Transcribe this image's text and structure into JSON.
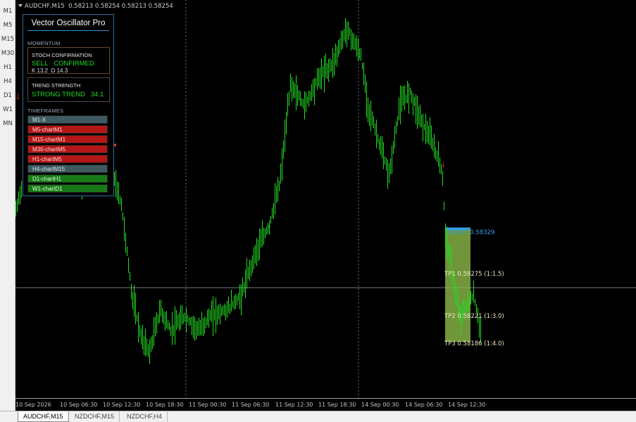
{
  "timeframes": [
    "M1",
    "M5",
    "M15",
    "M30",
    "H1",
    "H4",
    "D1",
    "W1",
    "MN"
  ],
  "chart": {
    "symbol": "AUDCHF,M15",
    "prices": "0.58213 0.58254 0.58213 0.58254"
  },
  "panel": {
    "title": "Vector Oscillator Pro",
    "momentum_label": "MOMENTUM",
    "stoch": {
      "heading": "STOCH CONFIRMATION",
      "signal": "SELL",
      "status": "CONFIRMED",
      "k": "K 13.2",
      "d": "D 14.3"
    },
    "trend": {
      "heading": "TREND STRENGTH",
      "status": "STRONG TREND",
      "value": "34.1"
    },
    "timeframes_label": "TIMEFRAMES",
    "tf_rows": [
      {
        "label": "M1-X",
        "state": "neutral"
      },
      {
        "label": "M5-chartM1",
        "state": "sell"
      },
      {
        "label": "M15-chartM1",
        "state": "sell"
      },
      {
        "label": "M30-chartM5",
        "state": "sell"
      },
      {
        "label": "H1-chartM5",
        "state": "sell"
      },
      {
        "label": "H4-chartM15",
        "state": "neutral"
      },
      {
        "label": "D1-chartH1",
        "state": "buy"
      },
      {
        "label": "W1-chartD1",
        "state": "buy"
      }
    ]
  },
  "levels": {
    "entry": "ENTRY 0.58329",
    "tp1": "TP1 0.58275 (1:1.5)",
    "tp2": "TP2 0.58221 (1:3.0)",
    "tp3": "TP3 0.58186 (1:4.0)"
  },
  "time_labels": [
    "10 Sep 2026",
    "10 Sep 06:30",
    "10 Sep 12:30",
    "10 Sep 18:30",
    "11 Sep 00:30",
    "11 Sep 06:30",
    "11 Sep 12:30",
    "11 Sep 18:30",
    "14 Sep 00:30",
    "14 Sep 06:30",
    "14 Sep 12:30"
  ],
  "tabs": [
    "AUDCHF,M15",
    "NZDCHF,M15",
    "NZDCHF,H4"
  ],
  "active_tab": "AUDCHF,M15",
  "colors": {
    "candle": "#22dd22",
    "entry": "#2fa2ef",
    "tp_zone": "#8fbf4a",
    "sell_arrow": "#ff3300",
    "buy_arrow": "#22ee22"
  }
}
